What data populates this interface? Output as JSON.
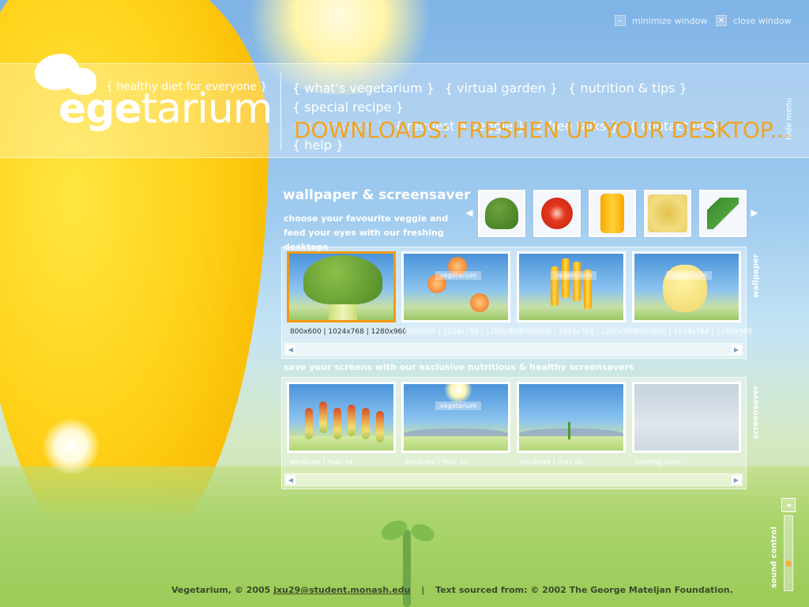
{
  "window": {
    "minimize_label": "minimize window",
    "close_label": "close window"
  },
  "logo": {
    "word_bold": "ege",
    "word_rest": "tarium",
    "tagline": "{ healthy diet for everyone }"
  },
  "nav": {
    "items": [
      {
        "label": "{ what's vegetarium }",
        "active": false
      },
      {
        "label": "{ virtual garden }",
        "active": false
      },
      {
        "label": "{ nutrition & tips }",
        "active": false
      },
      {
        "label": "{ special recipe }",
        "active": false
      },
      {
        "label": "{ downloads }",
        "active": true
      },
      {
        "label": "{ request a veggie }",
        "active": false
      },
      {
        "label": "{ free talks }",
        "active": false
      },
      {
        "label": "{ contact us }",
        "active": false
      },
      {
        "label": "{ help }",
        "active": false
      }
    ],
    "hide_menu": "hide menu"
  },
  "page": {
    "heading": "DOWNLOADS:  FRESHEN UP YOUR DESKTOP..."
  },
  "section": {
    "title": "wallpaper & screensaver",
    "description": "choose your favourite veggie and feed your eyes with our freshing desktops"
  },
  "veggie_strip": [
    "broccoli",
    "tomato",
    "pepper",
    "potato",
    "herb"
  ],
  "wallpaper": {
    "tab_label": "wallpaper",
    "items": [
      {
        "art": "broccoli",
        "label": "800x600 | 1024x768 | 1280x960",
        "selected": true
      },
      {
        "art": "tomato",
        "label": "800x600 | 1024x768 | 1280x960",
        "selected": false
      },
      {
        "art": "pepper",
        "label": "800x600 | 1024x768 | 1280x960",
        "selected": false
      },
      {
        "art": "potato",
        "label": "800x600 | 1024x768 | 1280x960",
        "selected": false
      }
    ]
  },
  "screensaver": {
    "heading": "save your screens with our exclusive nutritious & healthy screensavers",
    "tab_label": "screensaver",
    "items": [
      {
        "art": "veg-row",
        "label": "windows | mac os"
      },
      {
        "art": "sun-field",
        "label": "windows | mac os"
      },
      {
        "art": "sprout",
        "label": "windows | mac os"
      },
      {
        "art": "grey",
        "label": "coming soon ..."
      }
    ]
  },
  "sound": {
    "label": "sound control",
    "level": 0.35
  },
  "footer": {
    "credit": "Vegetarium, © 2005",
    "email": "jxu29@student.monash.edu",
    "separator": "|",
    "source": "Text sourced from: © 2002 The George Mateljan Foundation."
  },
  "colors": {
    "accent_orange": "#f5a21c",
    "selected_border": "#f29a12",
    "sky": "#7fb3e6",
    "grass": "#9ccb58"
  }
}
